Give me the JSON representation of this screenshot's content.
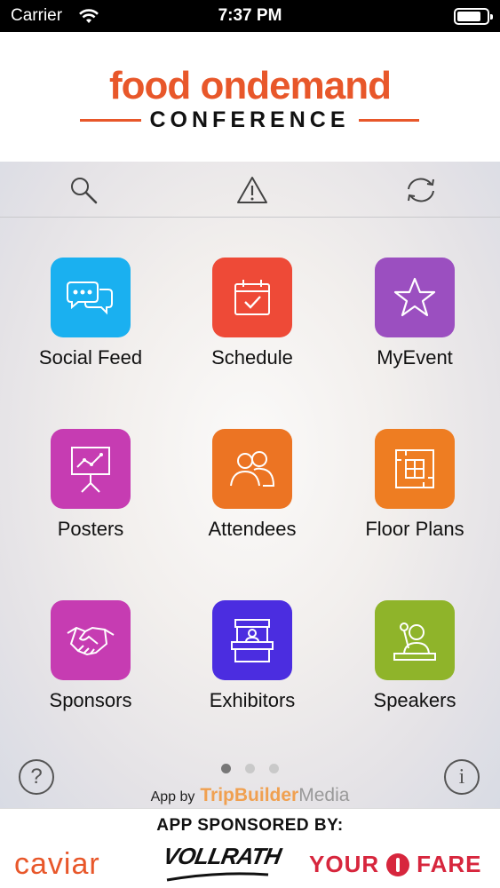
{
  "status_bar": {
    "carrier": "Carrier",
    "time": "7:37 PM"
  },
  "header": {
    "logo_main": "food ondemand",
    "logo_sub": "CONFERENCE"
  },
  "toolbar": {
    "icons": [
      "search-icon",
      "alert-icon",
      "sync-icon"
    ]
  },
  "tiles": [
    {
      "label": "Social Feed",
      "icon": "chat-bubbles-icon",
      "color": "#1ab0f0"
    },
    {
      "label": "Schedule",
      "icon": "calendar-check-icon",
      "color": "#ee4a37"
    },
    {
      "label": "MyEvent",
      "icon": "star-icon",
      "color": "#9b4fc0"
    },
    {
      "label": "Posters",
      "icon": "presentation-board-icon",
      "color": "#c63cb2"
    },
    {
      "label": "Attendees",
      "icon": "people-icon",
      "color": "#ec7423"
    },
    {
      "label": "Floor Plans",
      "icon": "floor-plan-icon",
      "color": "#ee7d22"
    },
    {
      "label": "Sponsors",
      "icon": "handshake-icon",
      "color": "#c63cb2"
    },
    {
      "label": "Exhibitors",
      "icon": "booth-icon",
      "color": "#4b2de0"
    },
    {
      "label": "Speakers",
      "icon": "speaker-podium-icon",
      "color": "#8fb42a"
    }
  ],
  "footer": {
    "help_label": "?",
    "info_label": "i",
    "page_dots": {
      "count": 3,
      "active": 0
    },
    "credit_prefix": "App by",
    "credit_brand_a": "TripBuilder",
    "credit_brand_b": "Media"
  },
  "banner": {
    "title": "APP SPONSORED BY:",
    "sponsors": [
      "caviar",
      "VOLLRATH",
      "YOUR",
      "FARE"
    ]
  }
}
